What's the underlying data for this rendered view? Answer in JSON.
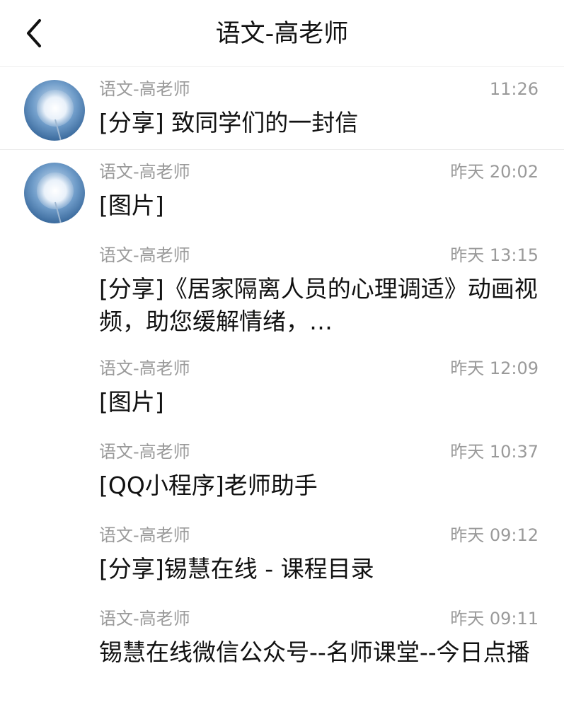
{
  "header": {
    "title": "语文-高老师",
    "back_icon": "chevron-left-icon"
  },
  "messages": [
    {
      "sender": "语文-高老师",
      "time": "11:26",
      "content": "[分享] 致同学们的一封信",
      "has_avatar": true
    },
    {
      "sender": "语文-高老师",
      "time": "昨天 20:02",
      "content": "[图片]",
      "has_avatar": true
    },
    {
      "sender": "语文-高老师",
      "time": "昨天 13:15",
      "content": "[分享]《居家隔离人员的心理调适》动画视频，助您缓解情绪，…",
      "has_avatar": false
    },
    {
      "sender": "语文-高老师",
      "time": "昨天 12:09",
      "content": "[图片]",
      "has_avatar": false
    },
    {
      "sender": "语文-高老师",
      "time": "昨天 10:37",
      "content": "[QQ小程序]老师助手",
      "has_avatar": false
    },
    {
      "sender": "语文-高老师",
      "time": "昨天 09:12",
      "content": "[分享]锡慧在线 - 课程目录",
      "has_avatar": false
    },
    {
      "sender": "语文-高老师",
      "time": "昨天 09:11",
      "content": "锡慧在线微信公众号--名师课堂--今日点播",
      "has_avatar": false
    }
  ]
}
